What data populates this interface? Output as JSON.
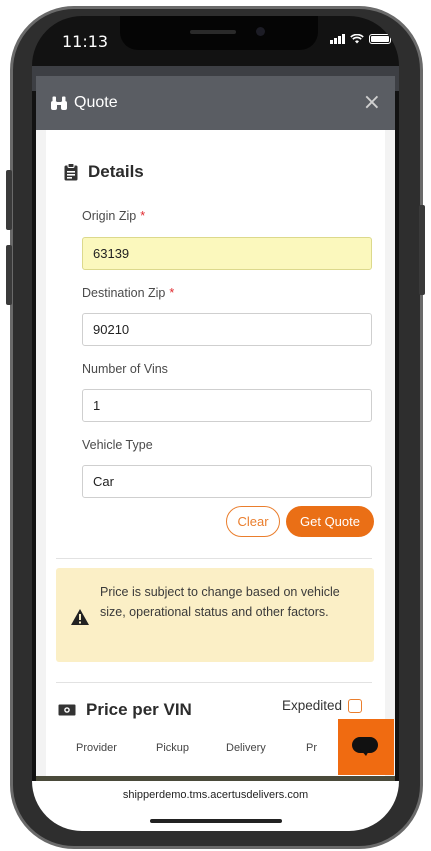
{
  "status_bar": {
    "time": "11:13"
  },
  "modal": {
    "title": "Quote",
    "close_symbol": "×",
    "header_icon": "binoculars-icon"
  },
  "details": {
    "title": "Details",
    "icon": "clipboard-icon",
    "origin_zip": {
      "label": "Origin Zip",
      "required_mark": "*",
      "value": "63139"
    },
    "destination_zip": {
      "label": "Destination Zip",
      "required_mark": "*",
      "value": "90210"
    },
    "number_of_vins": {
      "label": "Number of Vins",
      "value": "1"
    },
    "vehicle_type": {
      "label": "Vehicle Type",
      "value": "Car"
    },
    "clear_label": "Clear",
    "get_quote_label": "Get Quote"
  },
  "notice": {
    "text": "Price is subject to change based on vehicle size, operational status and other factors.",
    "icon": "warning-icon"
  },
  "price_per_vin": {
    "title": "Price per VIN",
    "icon": "money-icon",
    "expedited_label": "Expedited",
    "expedited_checked": false,
    "columns": [
      "Provider",
      "Pickup",
      "Delivery",
      "Pr"
    ]
  },
  "browser": {
    "url": "shipperdemo.tms.acertusdelivers.com"
  },
  "colors": {
    "accent": "#ea6f16",
    "header": "#5a5d63",
    "notice_bg": "#fbefc6",
    "highlight_field": "#fbf8bd",
    "required": "#e0292e"
  }
}
